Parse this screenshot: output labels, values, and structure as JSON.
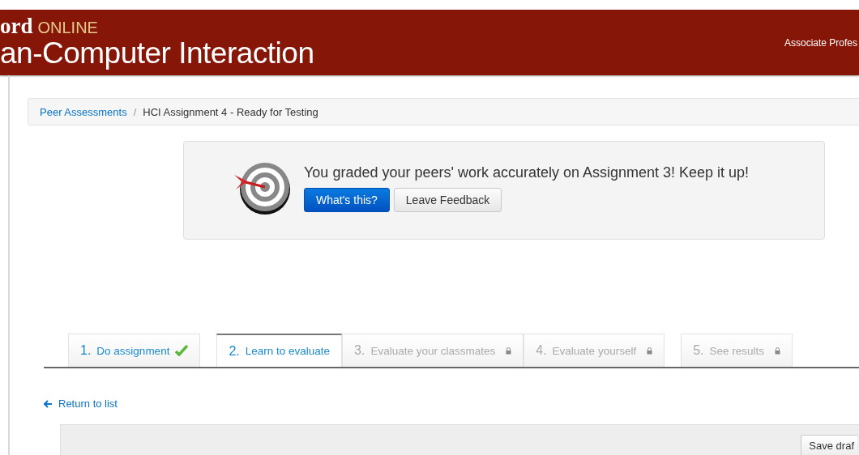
{
  "header": {
    "brand": "ord",
    "brand_suffix": "ONLINE",
    "title": "an-Computer Interaction",
    "user": "Associate Profes"
  },
  "breadcrumb": [
    {
      "label": "Peer Assessments",
      "kind": "link"
    },
    {
      "label": "/",
      "kind": "separator"
    },
    {
      "label": "HCI Assignment 4 - Ready for Testing",
      "kind": "current"
    }
  ],
  "notice": {
    "message": "You graded your peers' work accurately on Assignment 3! Keep it up!",
    "buttons": [
      {
        "label": "What's this?",
        "kind": "primary"
      },
      {
        "label": "Leave Feedback",
        "kind": "default"
      }
    ]
  },
  "steps": [
    {
      "number": "1.",
      "label": "Do assignment",
      "selected": false,
      "kind": "done"
    },
    {
      "number": "2.",
      "label": "Learn to evaluate",
      "selected": true,
      "kind": "open"
    },
    {
      "number": "3.",
      "label": "Evaluate your classmates",
      "selected": false,
      "kind": "locked"
    },
    {
      "number": "4.",
      "label": "Evaluate yourself",
      "selected": false,
      "kind": "locked"
    },
    {
      "number": "5.",
      "label": "See results",
      "selected": false,
      "kind": "locked"
    }
  ],
  "return_link": "Return to list",
  "panel": {
    "button": "Save draf"
  }
}
